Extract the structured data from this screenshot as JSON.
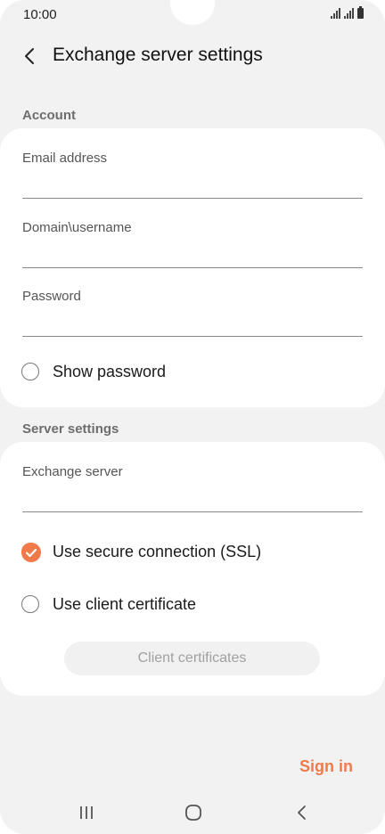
{
  "status_bar": {
    "time": "10:00"
  },
  "header": {
    "title": "Exchange server settings"
  },
  "account": {
    "section_label": "Account",
    "email_label": "Email address",
    "email_value": "",
    "username_label": "Domain\\username",
    "username_value": "",
    "password_label": "Password",
    "password_value": "",
    "show_password_label": "Show password",
    "show_password_checked": false
  },
  "server": {
    "section_label": "Server settings",
    "exchange_server_label": "Exchange server",
    "exchange_server_value": "",
    "ssl_label": "Use secure connection (SSL)",
    "ssl_checked": true,
    "client_cert_label": "Use client certificate",
    "client_cert_checked": false,
    "client_certificates_button": "Client certificates"
  },
  "footer": {
    "sign_in_label": "Sign in"
  },
  "colors": {
    "accent": "#f07a4a",
    "background": "#f2f2f2",
    "card": "#ffffff"
  },
  "icons": {
    "back": "chevron-left-icon",
    "recents": "recent-apps-icon",
    "home": "home-icon",
    "nav_back": "nav-back-icon"
  }
}
